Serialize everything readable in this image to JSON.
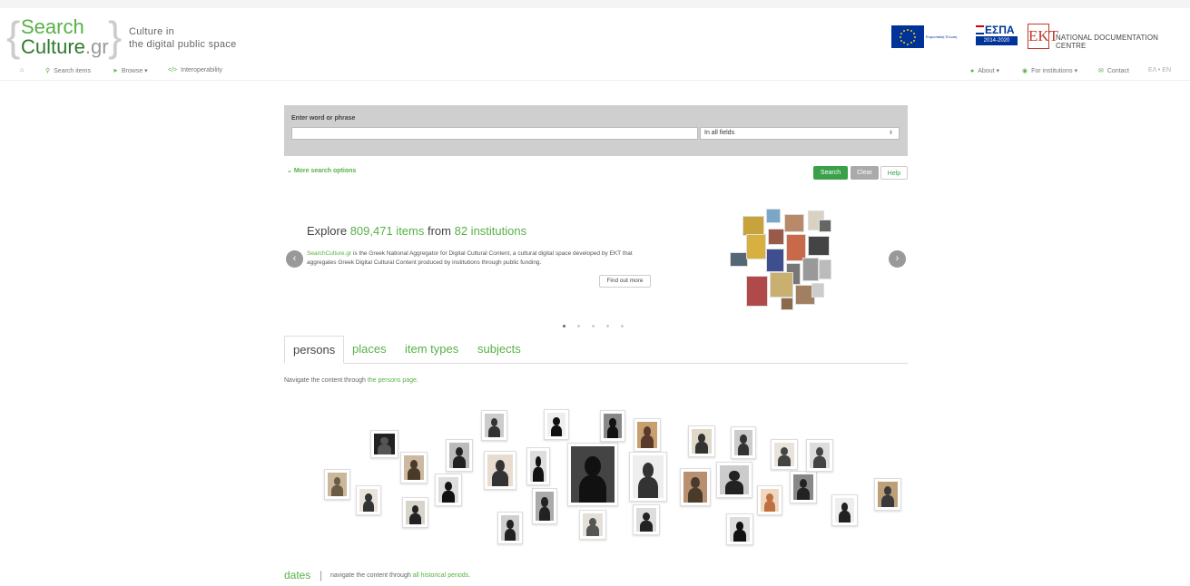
{
  "header": {
    "logo_line1": "Search",
    "logo_line2_main": "Culture",
    "logo_line2_suffix": ".gr",
    "tagline_line1": "Culture in",
    "tagline_line2": "the digital public space",
    "eu_text": "Ευρωπαϊκή Ένωση",
    "espa_title": "ΕΣΠΑ",
    "espa_years": "2014-2020",
    "ekt_logo": "EKT",
    "ekt_name": "NATIONAL DOCUMENTATION CENTRE"
  },
  "nav": {
    "search_items": "Search items",
    "browse": "Browse",
    "interoperability": "Interoperability",
    "about": "About",
    "for_institutions": "For institutions",
    "contact": "Contact",
    "lang": "ΕΛ • EN"
  },
  "search": {
    "label": "Enter word or phrase",
    "input_value": "",
    "field_select": "In all fields",
    "more_options": "More search options",
    "search_btn": "Search",
    "clear_btn": "Clear",
    "help_btn": "Help"
  },
  "carousel": {
    "explore_prefix": "Explore ",
    "items_count": "809,471 items",
    "explore_mid": " from ",
    "institutions": "82 institutions",
    "desc_link": "SearchCulture.gr",
    "desc_text": " is the Greek National Aggregator for Digital Cultural Content, a cultural digital space developed by EKT that aggregates Greek Digital Cultural Content produced by institutions through public funding.",
    "find_more": "Find out more",
    "slides": 5,
    "active_slide": 1
  },
  "tabs": [
    {
      "label": "persons",
      "active": true
    },
    {
      "label": "places",
      "active": false
    },
    {
      "label": "item types",
      "active": false
    },
    {
      "label": "subjects",
      "active": false
    }
  ],
  "persons": {
    "nav_prefix": "Navigate the content through ",
    "nav_link": "the persons page",
    "nav_suffix": "."
  },
  "dates": {
    "label": "dates",
    "sep": "|",
    "text_prefix": "navigate the content through ",
    "text_link": "all historical periods",
    "text_suffix": "."
  },
  "colors": {
    "brand_green": "#58b147",
    "button_green": "#3aa14a",
    "panel_grey": "#cfcfcf"
  }
}
